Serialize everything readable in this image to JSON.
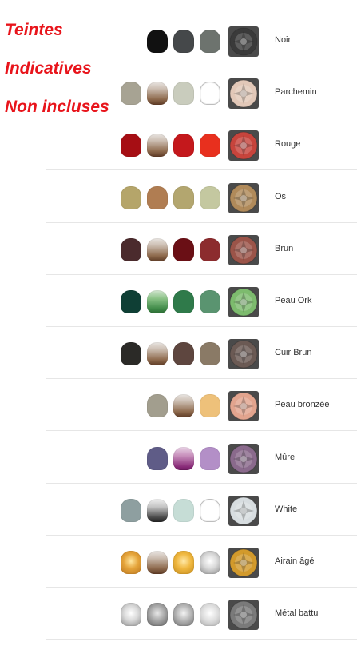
{
  "notice": {
    "line1": "Teintes",
    "line2": "Indicatives",
    "line3": "Non incluses",
    "color": "#e8141b"
  },
  "rows": [
    {
      "label": "Noir",
      "pots": [
        "#111111",
        "#45484a",
        "#6d736e"
      ]
    },
    {
      "label": "Parchemin",
      "pots": [
        "#a7a393",
        "gradient-brown",
        "#c9ccbd",
        "outline"
      ]
    },
    {
      "label": "Rouge",
      "pots": [
        "#a60e14",
        "gradient-brown",
        "#c4181c",
        "#e8301e"
      ]
    },
    {
      "label": "Os",
      "pots": [
        "#b5a56a",
        "#b07d52",
        "#b3a66f",
        "#c4c8a0"
      ]
    },
    {
      "label": "Brun",
      "pots": [
        "#4b2b2d",
        "gradient-brown",
        "#6a0f15",
        "#8c2c2e"
      ]
    },
    {
      "label": "Peau Ork",
      "pots": [
        "#0f3f35",
        "gradient-green",
        "#2f7a4a",
        "#5a9470"
      ]
    },
    {
      "label": "Cuir Brun",
      "pots": [
        "#2b2a27",
        "gradient-brown",
        "#5e463f",
        "#8a7a66"
      ]
    },
    {
      "label": "Peau bronzée",
      "pots": [
        "#a29e8e",
        "gradient-brown",
        "#eec17a"
      ]
    },
    {
      "label": "Mûre",
      "pots": [
        "#5f5c87",
        "gradient-purple",
        "#b38fc7"
      ]
    },
    {
      "label": "White",
      "pots": [
        "#8e9fa0",
        "gradient-grey",
        "#c6ddd6",
        "outline"
      ]
    },
    {
      "label": "Airain âgé",
      "pots": [
        "gradient-gold",
        "gradient-brown",
        "gradient-gold2",
        "gradient-silver"
      ]
    },
    {
      "label": "Métal battu",
      "pots": [
        "gradient-silver",
        "gradient-silver2",
        "gradient-silver3",
        "gradient-silver4"
      ]
    }
  ],
  "minis": [
    "#3a3a3a",
    "#e2c8b8",
    "#c7443c",
    "#b08a5a",
    "#9b5449",
    "#7dbb6e",
    "#6b5a54",
    "#e2a48e",
    "#8a6a8c",
    "#d7dde0",
    "#d29a2c",
    "#7a7a7a"
  ],
  "colors": {
    "divider": "#e6e6e6",
    "label": "#333333"
  }
}
